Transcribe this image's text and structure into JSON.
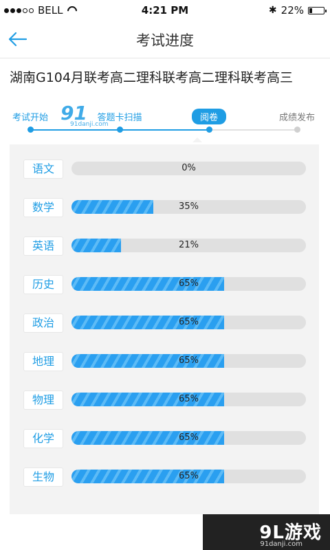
{
  "status_bar": {
    "carrier": "BELL",
    "time": "4:21 PM",
    "battery_text": "22%",
    "battery_level": 0.22
  },
  "nav": {
    "title": "考试进度",
    "back_icon": "back-arrow-icon"
  },
  "exam": {
    "name": "湖南G104月联考高二理科联考高二理科联考高三"
  },
  "steps": [
    {
      "label": "考试开始",
      "state": "done"
    },
    {
      "label": "答题卡扫描",
      "state": "done"
    },
    {
      "label": "阅卷",
      "state": "current"
    },
    {
      "label": "成绩发布",
      "state": "pending"
    }
  ],
  "subjects": [
    {
      "name": "语文",
      "progress_text": "0%",
      "progress": 0
    },
    {
      "name": "数学",
      "progress_text": "35%",
      "progress": 0.35
    },
    {
      "name": "英语",
      "progress_text": "21%",
      "progress": 0.21
    },
    {
      "name": "历史",
      "progress_text": "65%",
      "progress": 0.65
    },
    {
      "name": "政治",
      "progress_text": "65%",
      "progress": 0.65
    },
    {
      "name": "地理",
      "progress_text": "65%",
      "progress": 0.65
    },
    {
      "name": "物理",
      "progress_text": "65%",
      "progress": 0.65
    },
    {
      "name": "化学",
      "progress_text": "65%",
      "progress": 0.65
    },
    {
      "name": "生物",
      "progress_text": "65%",
      "progress": 0.65
    }
  ],
  "watermark": {
    "logo": "91",
    "brand": "9L游戏",
    "url": "91danji.com"
  },
  "colors": {
    "accent": "#1f9de4",
    "track": "#e0e0e0",
    "panel": "#f3f3f3"
  }
}
